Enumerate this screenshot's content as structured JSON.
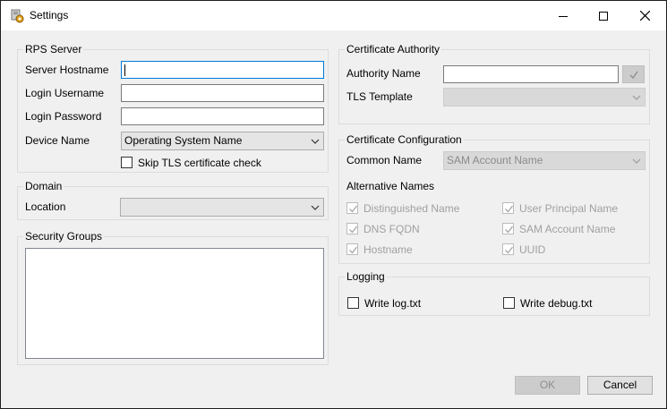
{
  "window": {
    "title": "Settings"
  },
  "rps_server": {
    "group_title": "RPS Server",
    "hostname_label": "Server Hostname",
    "hostname_value": "",
    "username_label": "Login Username",
    "username_value": "",
    "password_label": "Login Password",
    "password_value": "",
    "device_name_label": "Device Name",
    "device_name_selected": "Operating System Name",
    "skip_tls_label": "Skip TLS certificate check",
    "skip_tls_checked": false
  },
  "domain": {
    "group_title": "Domain",
    "location_label": "Location",
    "location_selected": ""
  },
  "security_groups": {
    "group_title": "Security Groups",
    "items": []
  },
  "certificate_authority": {
    "group_title": "Certificate Authority",
    "authority_name_label": "Authority Name",
    "authority_name_value": "",
    "tls_template_label": "TLS Template",
    "tls_template_selected": ""
  },
  "certificate_configuration": {
    "group_title": "Certificate Configuration",
    "common_name_label": "Common Name",
    "common_name_selected": "SAM Account Name",
    "alternative_names_label": "Alternative Names",
    "alternative_names": [
      {
        "label": "Distinguished Name",
        "checked": true,
        "enabled": false
      },
      {
        "label": "User Principal Name",
        "checked": true,
        "enabled": false
      },
      {
        "label": "DNS FQDN",
        "checked": true,
        "enabled": false
      },
      {
        "label": "SAM Account Name",
        "checked": true,
        "enabled": false
      },
      {
        "label": "Hostname",
        "checked": true,
        "enabled": false
      },
      {
        "label": "UUID",
        "checked": true,
        "enabled": false
      }
    ]
  },
  "logging": {
    "group_title": "Logging",
    "write_log_label": "Write log.txt",
    "write_log_checked": false,
    "write_debug_label": "Write debug.txt",
    "write_debug_checked": false
  },
  "buttons": {
    "ok_label": "OK",
    "cancel_label": "Cancel"
  },
  "icons": {
    "app": "settings-app-icon",
    "minimize": "minimize-icon",
    "maximize": "maximize-icon",
    "close": "close-icon",
    "dropdown": "chevron-down-icon",
    "check": "checkmark-icon"
  },
  "colors": {
    "focus_border": "#0078d7",
    "disabled_text": "#a0a0a0",
    "window_bg": "#f0f0f0"
  }
}
